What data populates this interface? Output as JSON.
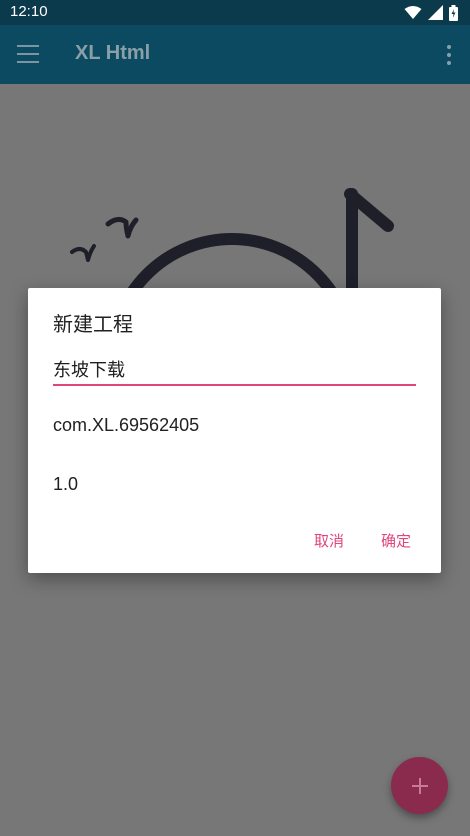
{
  "status_bar": {
    "time": "12:10"
  },
  "app_bar": {
    "title": "XL Html"
  },
  "dialog": {
    "title": "新建工程",
    "name_value": "东坡下载",
    "package_value": "com.XL.69562405",
    "version_value": "1.0",
    "cancel_label": "取消",
    "ok_label": "确定"
  },
  "colors": {
    "accent": "#e0457d",
    "app_bar": "#0b4a60",
    "fab": "#8a2a4c"
  },
  "icons": [
    "menu-icon",
    "overflow-icon",
    "wifi-icon",
    "signal-icon",
    "battery-icon",
    "add-icon"
  ]
}
